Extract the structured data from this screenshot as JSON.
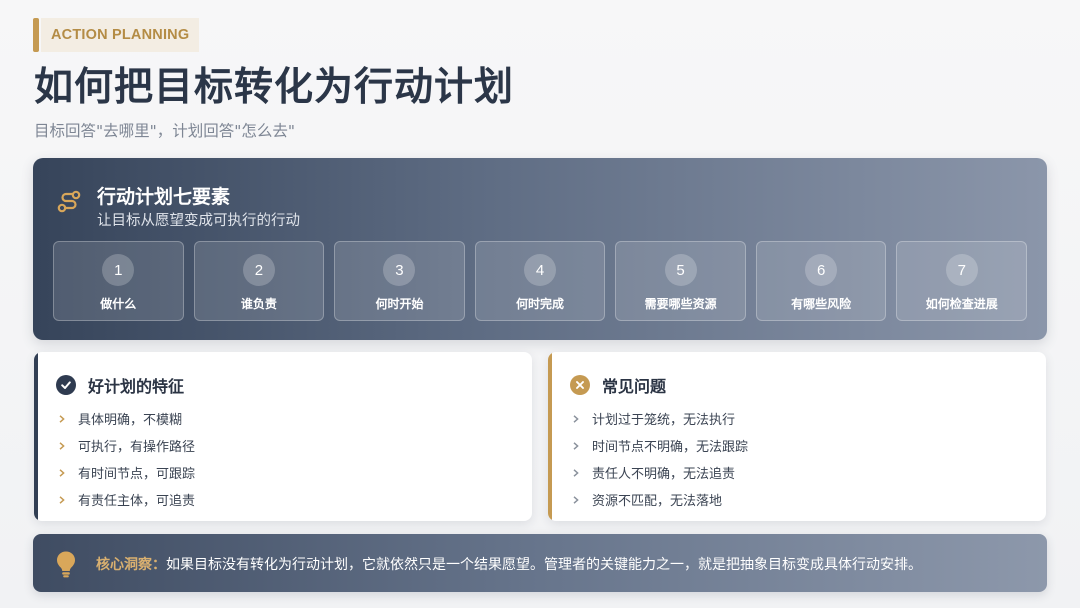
{
  "header": {
    "eyebrow": "ACTION PLANNING",
    "title": "如何把目标转化为行动计划",
    "subtitle": "目标回答\"去哪里\"，计划回答\"怎么去\""
  },
  "hero": {
    "icon": "route-icon",
    "title": "行动计划七要素",
    "subtitle": "让目标从愿望变成可执行的行动",
    "steps": [
      {
        "num": "1",
        "label": "做什么"
      },
      {
        "num": "2",
        "label": "谁负责"
      },
      {
        "num": "3",
        "label": "何时开始"
      },
      {
        "num": "4",
        "label": "何时完成"
      },
      {
        "num": "5",
        "label": "需要哪些资源"
      },
      {
        "num": "6",
        "label": "有哪些风险"
      },
      {
        "num": "7",
        "label": "如何检查进展"
      }
    ]
  },
  "good": {
    "icon": "check-circle-icon",
    "title": "好计划的特征",
    "items": [
      "具体明确，不模糊",
      "可执行，有操作路径",
      "有时间节点，可跟踪",
      "有责任主体，可追责"
    ]
  },
  "problems": {
    "icon": "x-circle-icon",
    "title": "常见问题",
    "items": [
      "计划过于笼统，无法执行",
      "时间节点不明确，无法跟踪",
      "责任人不明确，无法追责",
      "资源不匹配，无法落地"
    ]
  },
  "insight": {
    "icon": "lightbulb-icon",
    "lead": "核心洞察：",
    "text": "如果目标没有转化为行动计划，它就依然只是一个结果愿望。管理者的关键能力之一，就是把抽象目标变成具体行动安排。"
  },
  "colors": {
    "gold": "#c59a52",
    "navy": "#323f54"
  }
}
